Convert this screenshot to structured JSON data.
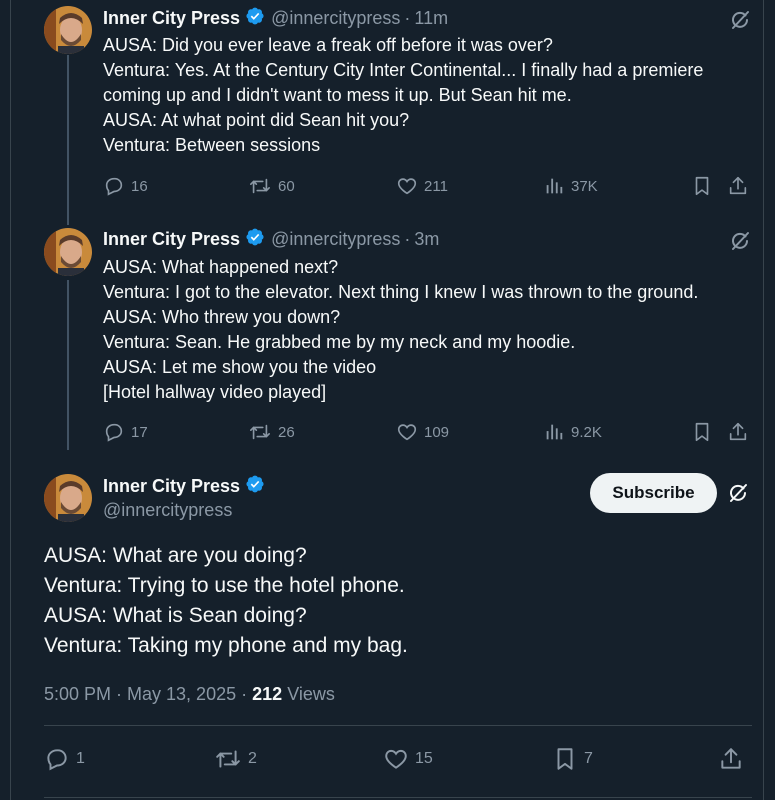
{
  "tweets": [
    {
      "name": "Inner City Press",
      "handle": "@innercitypress",
      "time": "11m",
      "lines": [
        "AUSA: Did you ever leave a freak off before it was over?",
        "Ventura: Yes. At the Century City Inter Continental... I finally had a premiere",
        "coming up and I didn't want to mess it up. But Sean hit me.",
        "AUSA: At what point did Sean hit you?",
        "Ventura: Between sessions"
      ],
      "replies": "16",
      "reposts": "60",
      "likes": "211",
      "views": "37K"
    },
    {
      "name": "Inner City Press",
      "handle": "@innercitypress",
      "time": "3m",
      "lines": [
        "AUSA: What happened next?",
        "Ventura: I got to the elevator. Next thing I knew I was thrown to the ground.",
        "AUSA: Who threw you down?",
        "Ventura: Sean. He grabbed me by my neck and my hoodie.",
        "AUSA: Let me show you the video",
        "[Hotel hallway video played]"
      ],
      "replies": "17",
      "reposts": "26",
      "likes": "109",
      "views": "9.2K"
    }
  ],
  "main": {
    "name": "Inner City Press",
    "handle": "@innercitypress",
    "subscribe_label": "Subscribe",
    "lines": [
      "AUSA: What are you doing?",
      "Ventura: Trying to use the hotel phone.",
      "AUSA: What is Sean doing?",
      "Ventura: Taking my phone and my bag."
    ],
    "timestamp": "5:00 PM · May 13, 2025",
    "sep": "·",
    "views_count": "212",
    "views_label": "Views",
    "replies": "1",
    "reposts": "2",
    "likes": "15",
    "bookmarks": "7"
  },
  "separator": "·",
  "colors": {
    "background": "#15202b",
    "text": "#f7f9f9",
    "muted": "#8b98a5",
    "verified": "#1d9bf0",
    "border": "#38444d"
  },
  "icons": [
    "verified-badge-icon",
    "grok-icon",
    "reply-icon",
    "repost-icon",
    "like-icon",
    "views-icon",
    "bookmark-icon",
    "share-icon"
  ]
}
